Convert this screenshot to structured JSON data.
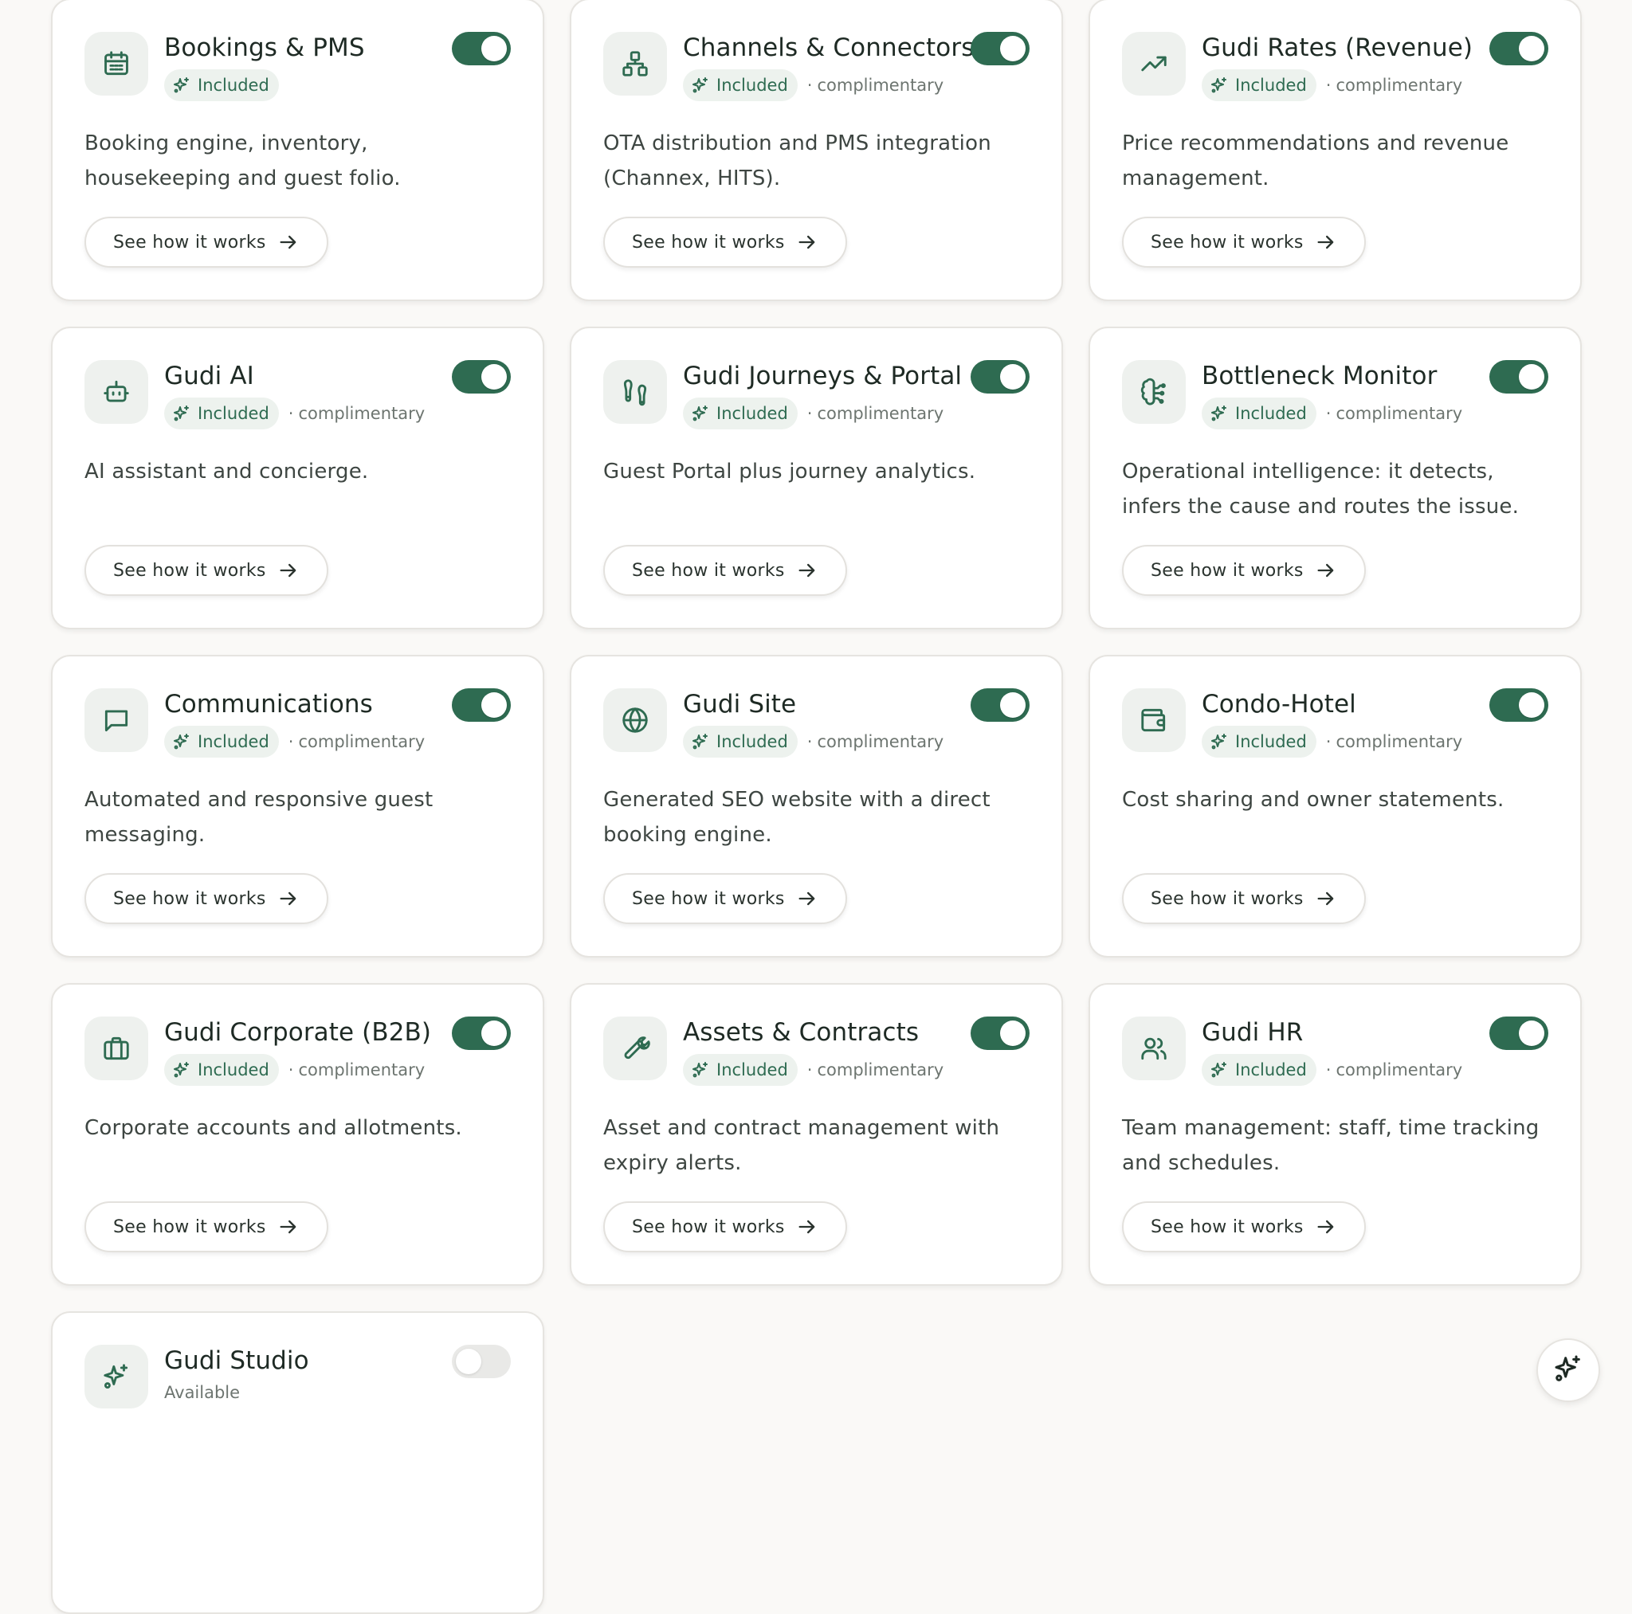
{
  "modules": [
    {
      "title": "Bookings & PMS",
      "included": "Included",
      "note": "",
      "description": "Booking engine, inventory, housekeeping and guest folio.",
      "cta": "See how it works",
      "enabled": true,
      "icon": "calendar-icon"
    },
    {
      "title": "Channels & Connectors",
      "included": "Included",
      "note": "complimentary",
      "description": "OTA distribution and PMS integration (Channex, HITS).",
      "cta": "See how it works",
      "enabled": true,
      "icon": "network-icon"
    },
    {
      "title": "Gudi Rates (Revenue)",
      "included": "Included",
      "note": "complimentary",
      "description": "Price recommendations and revenue management.",
      "cta": "See how it works",
      "enabled": true,
      "icon": "trending-up-icon"
    },
    {
      "title": "Gudi AI",
      "included": "Included",
      "note": "complimentary",
      "description": "AI assistant and concierge.",
      "cta": "See how it works",
      "enabled": true,
      "icon": "bot-icon"
    },
    {
      "title": "Gudi Journeys & Portal",
      "included": "Included",
      "note": "complimentary",
      "description": "Guest Portal plus journey analytics.",
      "cta": "See how it works",
      "enabled": true,
      "icon": "footprints-icon"
    },
    {
      "title": "Bottleneck Monitor",
      "included": "Included",
      "note": "complimentary",
      "description": "Operational intelligence: it detects, infers the cause and routes the issue.",
      "cta": "See how it works",
      "enabled": true,
      "icon": "brain-icon"
    },
    {
      "title": "Communications",
      "included": "Included",
      "note": "complimentary",
      "description": "Automated and responsive guest messaging.",
      "cta": "See how it works",
      "enabled": true,
      "icon": "message-icon"
    },
    {
      "title": "Gudi Site",
      "included": "Included",
      "note": "complimentary",
      "description": "Generated SEO website with a direct booking engine.",
      "cta": "See how it works",
      "enabled": true,
      "icon": "globe-icon"
    },
    {
      "title": "Condo-Hotel",
      "included": "Included",
      "note": "complimentary",
      "description": "Cost sharing and owner statements.",
      "cta": "See how it works",
      "enabled": true,
      "icon": "wallet-icon"
    },
    {
      "title": "Gudi Corporate (B2B)",
      "included": "Included",
      "note": "complimentary",
      "description": "Corporate accounts and allotments.",
      "cta": "See how it works",
      "enabled": true,
      "icon": "briefcase-icon"
    },
    {
      "title": "Assets & Contracts",
      "included": "Included",
      "note": "complimentary",
      "description": "Asset and contract management with expiry alerts.",
      "cta": "See how it works",
      "enabled": true,
      "icon": "wrench-icon"
    },
    {
      "title": "Gudi HR",
      "included": "Included",
      "note": "complimentary",
      "description": "Team management: staff, time tracking and schedules.",
      "cta": "See how it works",
      "enabled": true,
      "icon": "users-icon"
    },
    {
      "title": "Gudi Studio",
      "status": "Available",
      "enabled": false,
      "icon": "sparkles-icon"
    }
  ],
  "colors": {
    "accent": "#2e6b51",
    "badge_bg": "#edf2ee",
    "toggle_off": "#e9e9e7"
  },
  "fab": {
    "icon": "sparkles-icon"
  }
}
